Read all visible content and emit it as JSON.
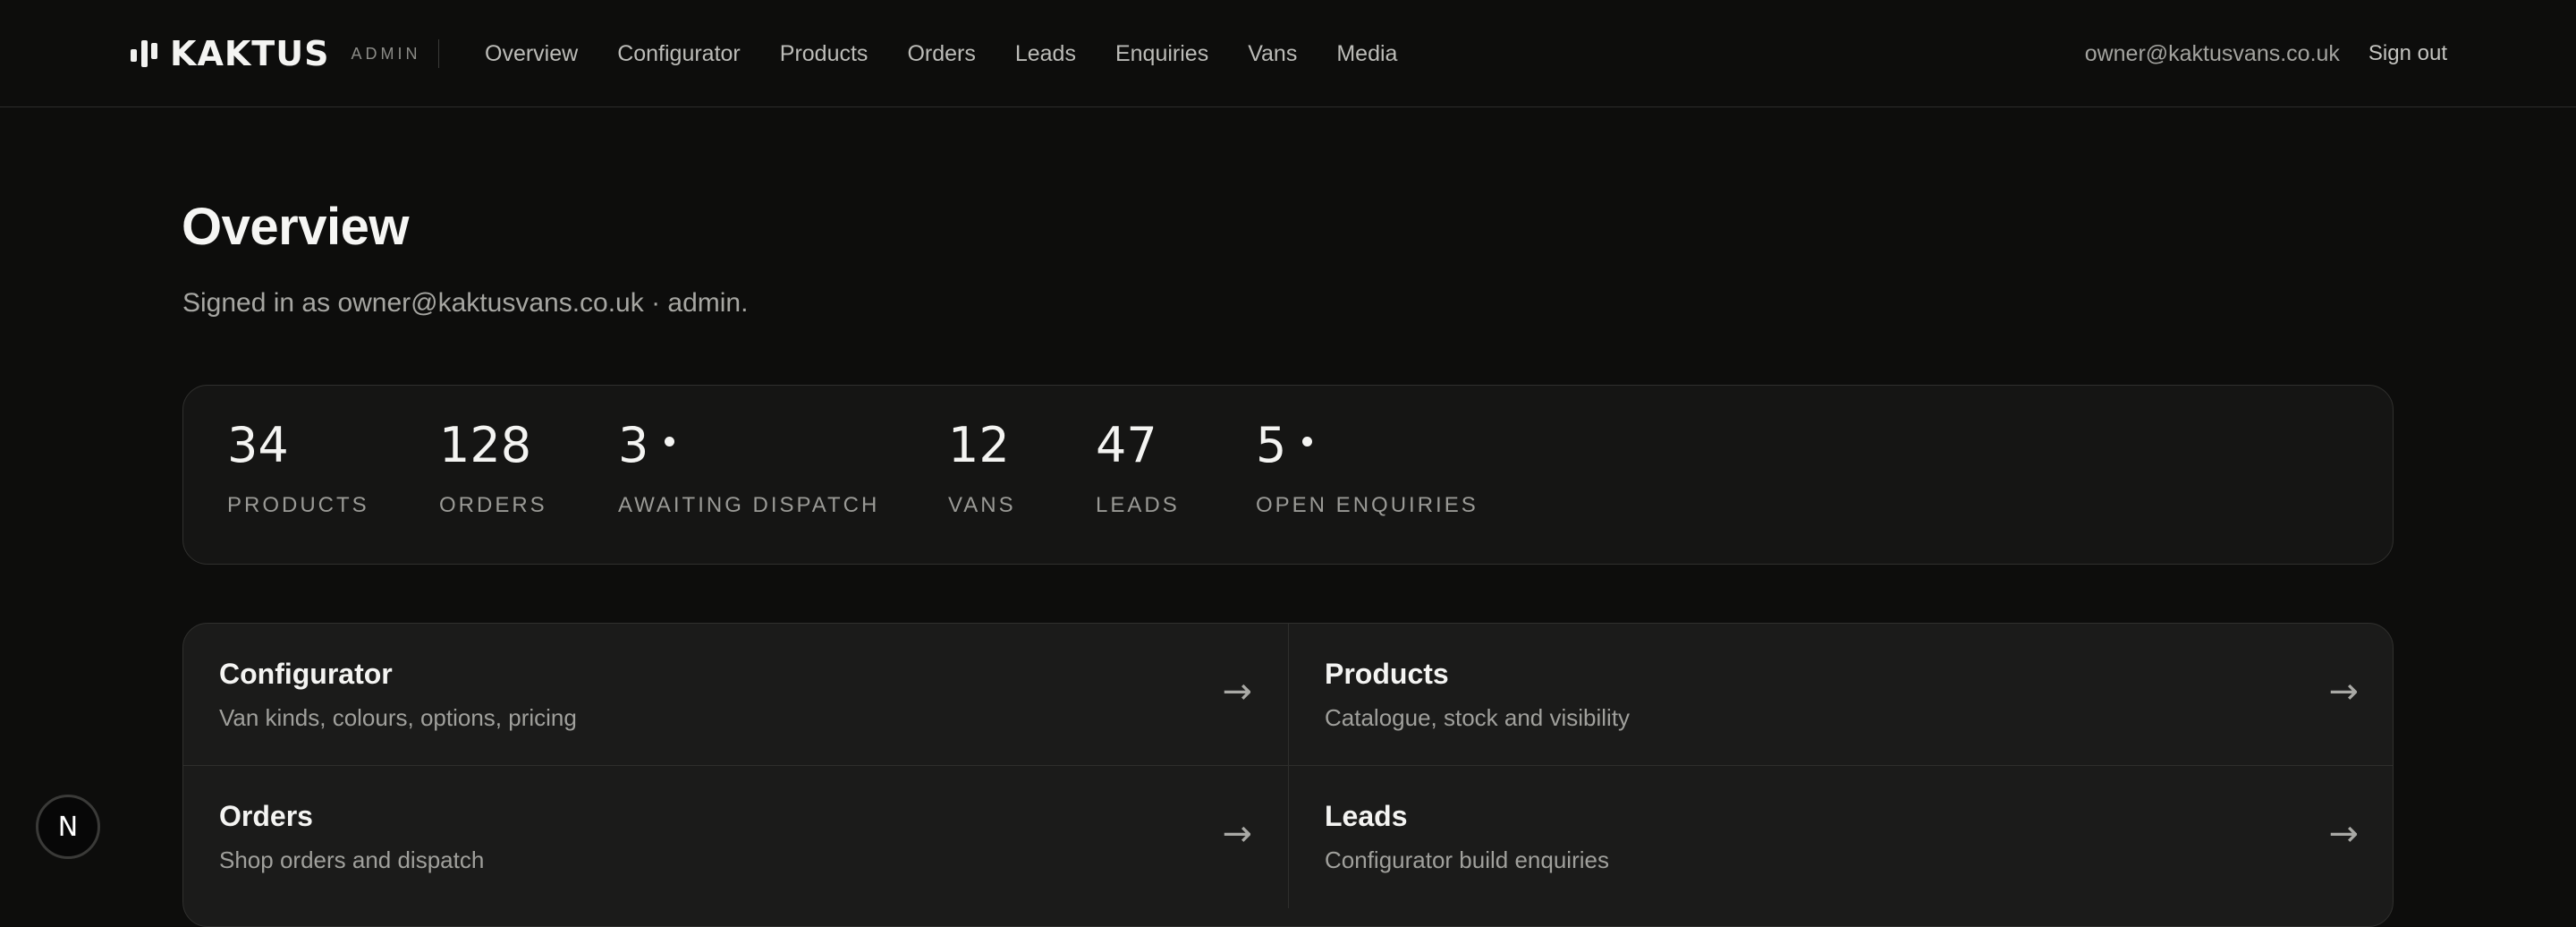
{
  "brand": {
    "name": "KAKTUS",
    "tag": "ADMIN"
  },
  "nav": {
    "items": [
      {
        "label": "Overview"
      },
      {
        "label": "Configurator"
      },
      {
        "label": "Products"
      },
      {
        "label": "Orders"
      },
      {
        "label": "Leads"
      },
      {
        "label": "Enquiries"
      },
      {
        "label": "Vans"
      },
      {
        "label": "Media"
      }
    ]
  },
  "account": {
    "email": "owner@kaktusvans.co.uk",
    "signout_label": "Sign out"
  },
  "page": {
    "title": "Overview",
    "subtitle": "Signed in as owner@kaktusvans.co.uk · admin."
  },
  "stats": [
    {
      "value": "34",
      "label": "PRODUCTS",
      "indicator": false
    },
    {
      "value": "128",
      "label": "ORDERS",
      "indicator": false
    },
    {
      "value": "3",
      "label": "AWAITING DISPATCH",
      "indicator": true
    },
    {
      "value": "12",
      "label": "VANS",
      "indicator": false
    },
    {
      "value": "47",
      "label": "LEADS",
      "indicator": false
    },
    {
      "value": "5",
      "label": "OPEN ENQUIRIES",
      "indicator": true
    }
  ],
  "cards": [
    {
      "title": "Configurator",
      "description": "Van kinds, colours, options, pricing",
      "arrow": "→"
    },
    {
      "title": "Products",
      "description": "Catalogue, stock and visibility",
      "arrow": "→"
    },
    {
      "title": "Orders",
      "description": "Shop orders and dispatch",
      "arrow": "→"
    },
    {
      "title": "Leads",
      "description": "Configurator build enquiries",
      "arrow": "→"
    }
  ],
  "dev_badge": {
    "letter": "N"
  }
}
